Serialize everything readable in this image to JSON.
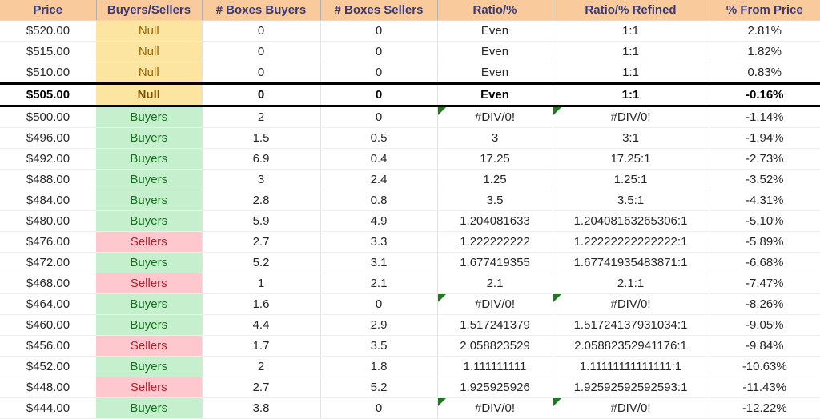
{
  "table": {
    "columns": [
      {
        "key": "price",
        "label": "Price"
      },
      {
        "key": "side",
        "label": "Buyers/Sellers"
      },
      {
        "key": "boxes_buy",
        "label": "# Boxes Buyers"
      },
      {
        "key": "boxes_sell",
        "label": "# Boxes Sellers"
      },
      {
        "key": "ratio",
        "label": "Ratio/%"
      },
      {
        "key": "ratio_ref",
        "label": "Ratio/% Refined"
      },
      {
        "key": "pct_from",
        "label": "% From Price"
      }
    ],
    "colors": {
      "header_bg": "#F9CB9C",
      "header_text": "#3A3A78",
      "null_bg": "#FCE5A0",
      "null_text": "#9C6500",
      "buyers_bg": "#C6EFCE",
      "buyers_text": "#15711F",
      "sellers_bg": "#FFC7CE",
      "sellers_text": "#B3232E",
      "error_flag": "#1E7A1E",
      "focus_border": "#000000"
    },
    "rows": [
      {
        "price": "$520.00",
        "side": "Null",
        "side_state": "null",
        "boxes_buy": "0",
        "boxes_sell": "0",
        "ratio": "Even",
        "ratio_ref": "1:1",
        "pct_from": "2.81%",
        "focus": false,
        "err_ratio": false,
        "err_ratio_ref": false
      },
      {
        "price": "$515.00",
        "side": "Null",
        "side_state": "null",
        "boxes_buy": "0",
        "boxes_sell": "0",
        "ratio": "Even",
        "ratio_ref": "1:1",
        "pct_from": "1.82%",
        "focus": false,
        "err_ratio": false,
        "err_ratio_ref": false
      },
      {
        "price": "$510.00",
        "side": "Null",
        "side_state": "null",
        "boxes_buy": "0",
        "boxes_sell": "0",
        "ratio": "Even",
        "ratio_ref": "1:1",
        "pct_from": "0.83%",
        "focus": false,
        "err_ratio": false,
        "err_ratio_ref": false
      },
      {
        "price": "$505.00",
        "side": "Null",
        "side_state": "null",
        "boxes_buy": "0",
        "boxes_sell": "0",
        "ratio": "Even",
        "ratio_ref": "1:1",
        "pct_from": "-0.16%",
        "focus": true,
        "err_ratio": false,
        "err_ratio_ref": false
      },
      {
        "price": "$500.00",
        "side": "Buyers",
        "side_state": "buyers",
        "boxes_buy": "2",
        "boxes_sell": "0",
        "ratio": "#DIV/0!",
        "ratio_ref": "#DIV/0!",
        "pct_from": "-1.14%",
        "focus": false,
        "err_ratio": true,
        "err_ratio_ref": true
      },
      {
        "price": "$496.00",
        "side": "Buyers",
        "side_state": "buyers",
        "boxes_buy": "1.5",
        "boxes_sell": "0.5",
        "ratio": "3",
        "ratio_ref": "3:1",
        "pct_from": "-1.94%",
        "focus": false,
        "err_ratio": false,
        "err_ratio_ref": false
      },
      {
        "price": "$492.00",
        "side": "Buyers",
        "side_state": "buyers",
        "boxes_buy": "6.9",
        "boxes_sell": "0.4",
        "ratio": "17.25",
        "ratio_ref": "17.25:1",
        "pct_from": "-2.73%",
        "focus": false,
        "err_ratio": false,
        "err_ratio_ref": false
      },
      {
        "price": "$488.00",
        "side": "Buyers",
        "side_state": "buyers",
        "boxes_buy": "3",
        "boxes_sell": "2.4",
        "ratio": "1.25",
        "ratio_ref": "1.25:1",
        "pct_from": "-3.52%",
        "focus": false,
        "err_ratio": false,
        "err_ratio_ref": false
      },
      {
        "price": "$484.00",
        "side": "Buyers",
        "side_state": "buyers",
        "boxes_buy": "2.8",
        "boxes_sell": "0.8",
        "ratio": "3.5",
        "ratio_ref": "3.5:1",
        "pct_from": "-4.31%",
        "focus": false,
        "err_ratio": false,
        "err_ratio_ref": false
      },
      {
        "price": "$480.00",
        "side": "Buyers",
        "side_state": "buyers",
        "boxes_buy": "5.9",
        "boxes_sell": "4.9",
        "ratio": "1.204081633",
        "ratio_ref": "1.20408163265306:1",
        "pct_from": "-5.10%",
        "focus": false,
        "err_ratio": false,
        "err_ratio_ref": false
      },
      {
        "price": "$476.00",
        "side": "Sellers",
        "side_state": "sellers",
        "boxes_buy": "2.7",
        "boxes_sell": "3.3",
        "ratio": "1.222222222",
        "ratio_ref": "1.22222222222222:1",
        "pct_from": "-5.89%",
        "focus": false,
        "err_ratio": false,
        "err_ratio_ref": false
      },
      {
        "price": "$472.00",
        "side": "Buyers",
        "side_state": "buyers",
        "boxes_buy": "5.2",
        "boxes_sell": "3.1",
        "ratio": "1.677419355",
        "ratio_ref": "1.67741935483871:1",
        "pct_from": "-6.68%",
        "focus": false,
        "err_ratio": false,
        "err_ratio_ref": false
      },
      {
        "price": "$468.00",
        "side": "Sellers",
        "side_state": "sellers",
        "boxes_buy": "1",
        "boxes_sell": "2.1",
        "ratio": "2.1",
        "ratio_ref": "2.1:1",
        "pct_from": "-7.47%",
        "focus": false,
        "err_ratio": false,
        "err_ratio_ref": false
      },
      {
        "price": "$464.00",
        "side": "Buyers",
        "side_state": "buyers",
        "boxes_buy": "1.6",
        "boxes_sell": "0",
        "ratio": "#DIV/0!",
        "ratio_ref": "#DIV/0!",
        "pct_from": "-8.26%",
        "focus": false,
        "err_ratio": true,
        "err_ratio_ref": true
      },
      {
        "price": "$460.00",
        "side": "Buyers",
        "side_state": "buyers",
        "boxes_buy": "4.4",
        "boxes_sell": "2.9",
        "ratio": "1.517241379",
        "ratio_ref": "1.51724137931034:1",
        "pct_from": "-9.05%",
        "focus": false,
        "err_ratio": false,
        "err_ratio_ref": false
      },
      {
        "price": "$456.00",
        "side": "Sellers",
        "side_state": "sellers",
        "boxes_buy": "1.7",
        "boxes_sell": "3.5",
        "ratio": "2.058823529",
        "ratio_ref": "2.05882352941176:1",
        "pct_from": "-9.84%",
        "focus": false,
        "err_ratio": false,
        "err_ratio_ref": false
      },
      {
        "price": "$452.00",
        "side": "Buyers",
        "side_state": "buyers",
        "boxes_buy": "2",
        "boxes_sell": "1.8",
        "ratio": "1.111111111",
        "ratio_ref": "1.11111111111111:1",
        "pct_from": "-10.63%",
        "focus": false,
        "err_ratio": false,
        "err_ratio_ref": false
      },
      {
        "price": "$448.00",
        "side": "Sellers",
        "side_state": "sellers",
        "boxes_buy": "2.7",
        "boxes_sell": "5.2",
        "ratio": "1.925925926",
        "ratio_ref": "1.92592592592593:1",
        "pct_from": "-11.43%",
        "focus": false,
        "err_ratio": false,
        "err_ratio_ref": false
      },
      {
        "price": "$444.00",
        "side": "Buyers",
        "side_state": "buyers",
        "boxes_buy": "3.8",
        "boxes_sell": "0",
        "ratio": "#DIV/0!",
        "ratio_ref": "#DIV/0!",
        "pct_from": "-12.22%",
        "focus": false,
        "err_ratio": true,
        "err_ratio_ref": true
      }
    ]
  }
}
